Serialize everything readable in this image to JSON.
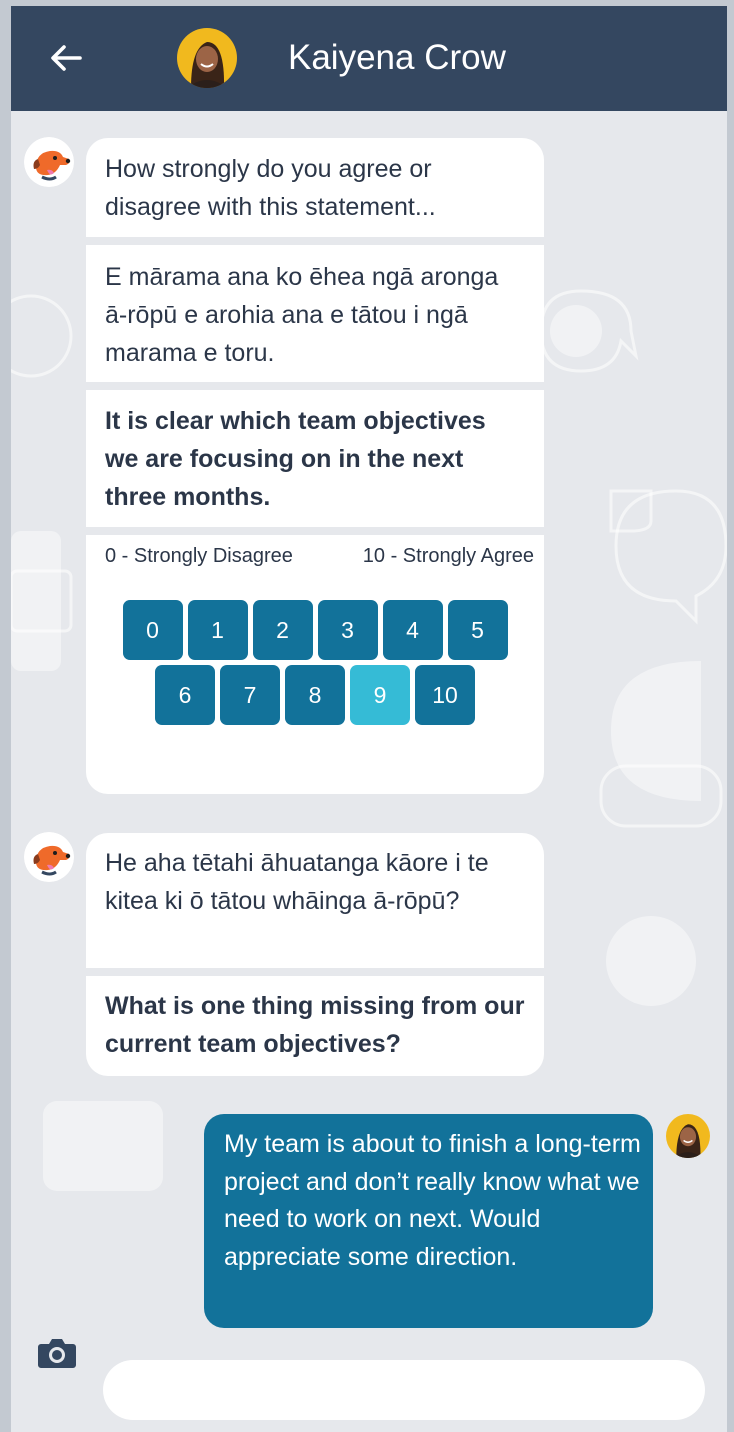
{
  "header": {
    "back_icon": "arrow-left-icon",
    "contact_name": "Kaiyena Crow",
    "bg_color": "#344760"
  },
  "messages": [
    {
      "sender": "bot",
      "avatar_icon": "dog-mascot-icon",
      "intro": "How strongly do you agree or disagree with this statement...",
      "maori": "E mārama ana ko ēhea ngā aronga ā-rōpū e arohia ana e tātou i ngā marama e toru.",
      "english": "It is clear which team objectives we are focusing on in the next three months.",
      "scale": {
        "min_label": "0 - Strongly Disagree",
        "max_label": "10 - Strongly Agree",
        "options": [
          "0",
          "1",
          "2",
          "3",
          "4",
          "5",
          "6",
          "7",
          "8",
          "9",
          "10"
        ],
        "selected": "9"
      }
    },
    {
      "sender": "bot",
      "avatar_icon": "dog-mascot-icon",
      "maori": "He aha tētahi āhuatanga kāore i te kitea ki ō tātou whāinga ā-rōpū?",
      "english": "What is one thing missing from our current team objectives?"
    },
    {
      "sender": "user",
      "avatar_icon": "user-avatar-photo",
      "text": "My team is about to finish a long-term project and don’t really know what we need to work on next. Would appreciate some direction."
    }
  ],
  "composer": {
    "camera_icon": "camera-icon",
    "input_value": "",
    "input_placeholder": ""
  },
  "colors": {
    "accent": "#12729a",
    "selected": "#35bbd6",
    "background": "#e6e8ec"
  }
}
